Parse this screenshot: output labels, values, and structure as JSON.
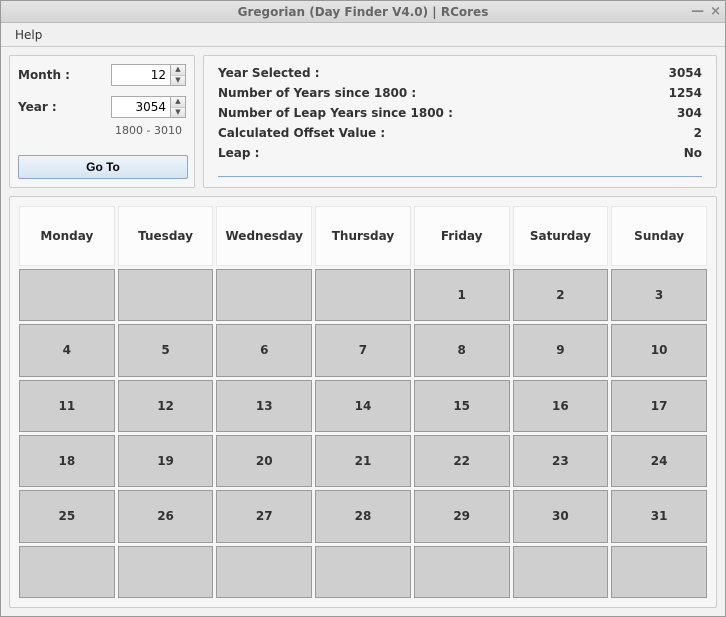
{
  "window": {
    "title": "Gregorian (Day Finder V4.0) | RCores"
  },
  "menu": {
    "help": "Help"
  },
  "inputs": {
    "month_label": "Month :",
    "month_value": "12",
    "year_label": "Year :",
    "year_value": "3054",
    "range_hint": "1800 - 3010",
    "goto_label": "Go To"
  },
  "info": {
    "year_selected_label": "Year Selected :",
    "year_selected_value": "3054",
    "years_since_label": "Number of Years since 1800 :",
    "years_since_value": "1254",
    "leap_since_label": "Number of Leap Years since 1800 :",
    "leap_since_value": "304",
    "offset_label": "Calculated Offset Value :",
    "offset_value": "2",
    "leap_label": "Leap :",
    "leap_value": "No"
  },
  "calendar": {
    "headers": [
      "Monday",
      "Tuesday",
      "Wednesday",
      "Thursday",
      "Friday",
      "Saturday",
      "Sunday"
    ],
    "rows": [
      [
        "",
        "",
        "",
        "",
        "1",
        "2",
        "3"
      ],
      [
        "4",
        "5",
        "6",
        "7",
        "8",
        "9",
        "10"
      ],
      [
        "11",
        "12",
        "13",
        "14",
        "15",
        "16",
        "17"
      ],
      [
        "18",
        "19",
        "20",
        "21",
        "22",
        "23",
        "24"
      ],
      [
        "25",
        "26",
        "27",
        "28",
        "29",
        "30",
        "31"
      ],
      [
        "",
        "",
        "",
        "",
        "",
        "",
        ""
      ]
    ]
  }
}
